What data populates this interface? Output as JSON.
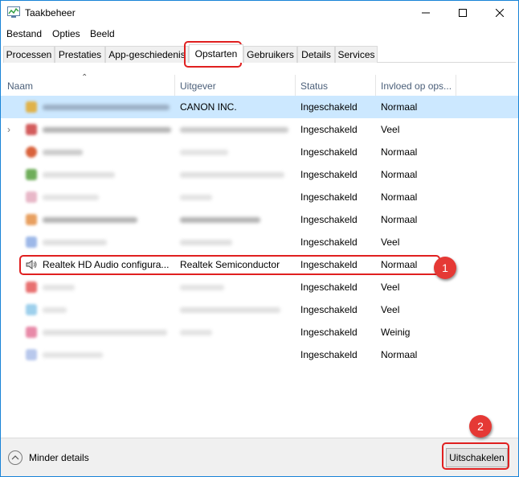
{
  "window": {
    "title": "Taakbeheer",
    "controls": {
      "minimize": "minimize",
      "maximize": "maximize",
      "close": "close"
    }
  },
  "menu": [
    "Bestand",
    "Opties",
    "Beeld"
  ],
  "tabs": [
    {
      "label": "Processen"
    },
    {
      "label": "Prestaties"
    },
    {
      "label": "App-geschiedenis"
    },
    {
      "label": "Opstarten",
      "active": true
    },
    {
      "label": "Gebruikers"
    },
    {
      "label": "Details"
    },
    {
      "label": "Services"
    }
  ],
  "columns": {
    "name": "Naam",
    "publisher": "Uitgever",
    "status": "Status",
    "impact": "Invloed op ops..."
  },
  "rows": [
    {
      "name": "",
      "publisher": "CANON INC.",
      "status": "Ingeschakeld",
      "impact": "Normaal",
      "selected": true
    },
    {
      "name": "",
      "publisher": "",
      "status": "Ingeschakeld",
      "impact": "Veel",
      "expandable": true
    },
    {
      "name": "",
      "publisher": "",
      "status": "Ingeschakeld",
      "impact": "Normaal"
    },
    {
      "name": "",
      "publisher": "",
      "status": "Ingeschakeld",
      "impact": "Normaal"
    },
    {
      "name": "",
      "publisher": "",
      "status": "Ingeschakeld",
      "impact": "Normaal"
    },
    {
      "name": "",
      "publisher": "",
      "status": "Ingeschakeld",
      "impact": "Normaal"
    },
    {
      "name": "",
      "publisher": "",
      "status": "Ingeschakeld",
      "impact": "Veel"
    },
    {
      "name": "Realtek HD Audio configura...",
      "publisher": "Realtek Semiconductor",
      "status": "Ingeschakeld",
      "impact": "Normaal",
      "icon": "speaker-icon"
    },
    {
      "name": "",
      "publisher": "",
      "status": "Ingeschakeld",
      "impact": "Veel"
    },
    {
      "name": "",
      "publisher": "",
      "status": "Ingeschakeld",
      "impact": "Veel"
    },
    {
      "name": "",
      "publisher": "",
      "status": "Ingeschakeld",
      "impact": "Weinig"
    },
    {
      "name": "",
      "publisher": "",
      "status": "Ingeschakeld",
      "impact": "Normaal"
    }
  ],
  "annotations": {
    "badge1": "1",
    "badge2": "2"
  },
  "footer": {
    "less_details": "Minder details",
    "disable_button": "Uitschakelen"
  },
  "colors": {
    "selection": "#cce8ff",
    "annotation": "#e02020",
    "window_border": "#1883d7"
  }
}
